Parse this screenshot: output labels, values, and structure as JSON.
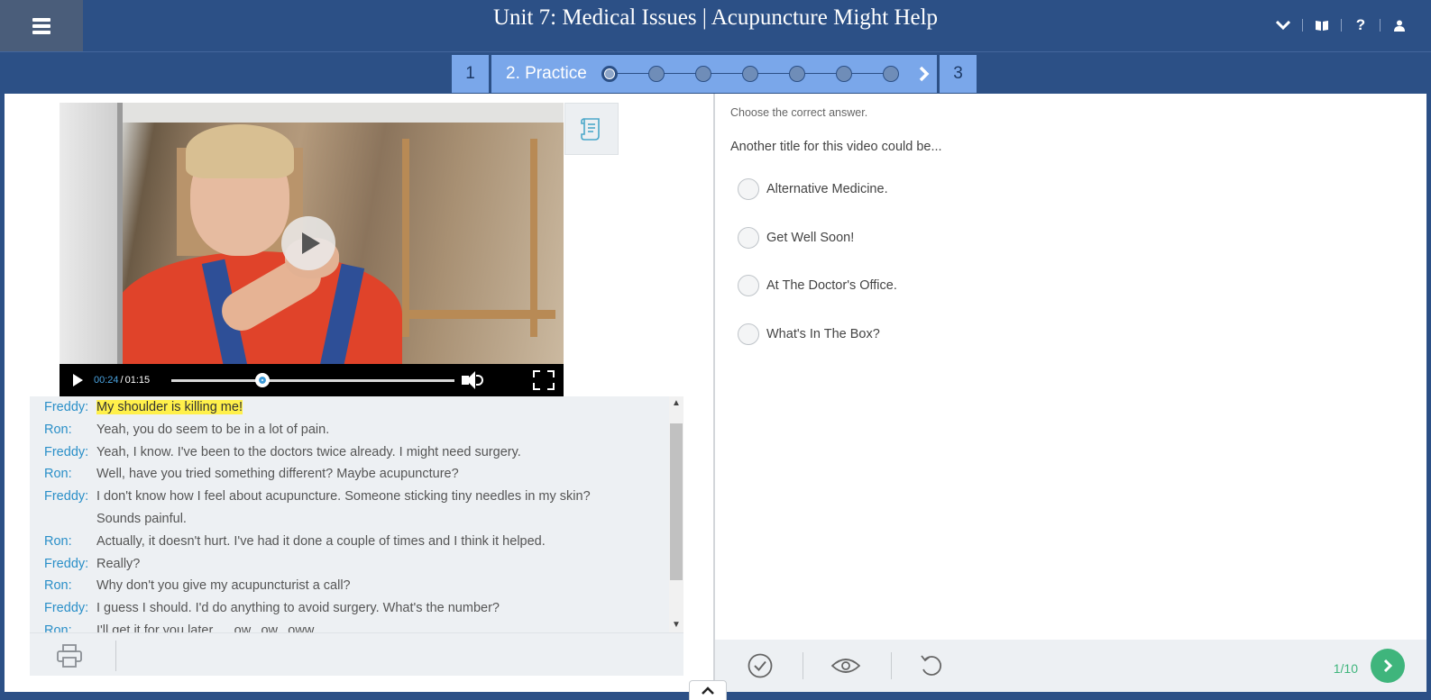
{
  "header": {
    "title": "Unit 7: Medical Issues | Acupuncture Might Help",
    "icons": [
      "hamburger-menu-icon",
      "chevron-down-icon",
      "book-icon",
      "help-icon",
      "user-icon"
    ],
    "help_glyph": "?"
  },
  "steps": {
    "prev_label": "1",
    "current_label": "2. Practice",
    "next_label": "3",
    "current_dot": 1
  },
  "video": {
    "current_time": "00:24",
    "duration": "01:15",
    "time_separator": "/",
    "progress": 0.32
  },
  "transcript": {
    "lines": [
      {
        "speaker": "Freddy:",
        "text": "My shoulder is killing me!",
        "highlight": true
      },
      {
        "speaker": "Ron:",
        "text": "Yeah, you do seem to be in a lot of pain."
      },
      {
        "speaker": "Freddy:",
        "text": "Yeah, I know. I've been to the doctors twice already. I might need surgery."
      },
      {
        "speaker": "Ron:",
        "text": "Well, have you tried something different? Maybe acupuncture?"
      },
      {
        "speaker": "Freddy:",
        "text": "I don't know how I feel about acupuncture. Someone sticking tiny needles in my skin?"
      },
      {
        "speaker": "",
        "text": "Sounds painful."
      },
      {
        "speaker": "Ron:",
        "text": "Actually, it doesn't hurt. I've had it done a couple of times and I think it helped."
      },
      {
        "speaker": "Freddy:",
        "text": "Really?"
      },
      {
        "speaker": "Ron:",
        "text": "Why don't you give my acupuncturist a call?"
      },
      {
        "speaker": "Freddy:",
        "text": "I guess I should. I'd do anything to avoid surgery. What's the number?"
      },
      {
        "speaker": "Ron:",
        "text": "I'll get it for you later..... ow...ow...oww..."
      }
    ]
  },
  "exercise": {
    "instruction": "Choose the correct answer.",
    "question": "Another title for this video could be...",
    "options": [
      "Alternative Medicine.",
      "Get Well Soon!",
      "At The Doctor's Office.",
      "What's In The Box?"
    ],
    "counter": "1/10"
  },
  "colors": {
    "header_bg": "#2c5086",
    "step_bg": "#7aa7ea",
    "speaker": "#2a8fc8",
    "highlight": "#fff04a",
    "accent_green": "#3fb57c"
  }
}
